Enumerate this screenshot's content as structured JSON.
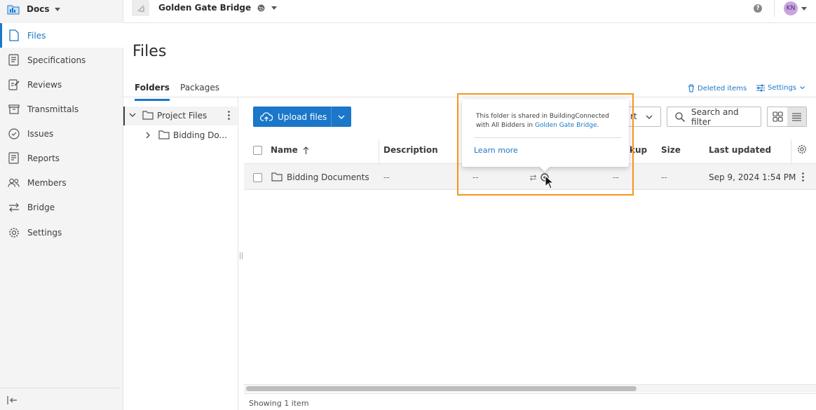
{
  "app": {
    "name": "Docs"
  },
  "project": {
    "name": "Golden Gate Bridge"
  },
  "user": {
    "initials": "KN"
  },
  "sidebar": {
    "items": [
      {
        "label": "Files"
      },
      {
        "label": "Specifications"
      },
      {
        "label": "Reviews"
      },
      {
        "label": "Transmittals"
      },
      {
        "label": "Issues"
      },
      {
        "label": "Reports"
      },
      {
        "label": "Members"
      },
      {
        "label": "Bridge"
      },
      {
        "label": "Settings"
      }
    ]
  },
  "page": {
    "title": "Files",
    "tabs": [
      {
        "label": "Folders"
      },
      {
        "label": "Packages"
      }
    ],
    "deleted_items": "Deleted items",
    "settings": "Settings"
  },
  "tree": {
    "root": "Project Files",
    "child": "Bidding Do..."
  },
  "toolbar": {
    "upload": "Upload files",
    "export_partial": "rt",
    "search_filter": "Search and filter"
  },
  "table": {
    "columns": {
      "name": "Name",
      "description": "Description",
      "markup_partial": "kup",
      "size": "Size",
      "last_updated": "Last updated"
    },
    "rows": [
      {
        "name": "Bidding Documents",
        "description": "--",
        "version": "--",
        "markup": "--",
        "size": "--",
        "last_updated": "Sep 9, 2024 1:54 PM"
      }
    ]
  },
  "tooltip": {
    "text_prefix": "This folder is shared in BuildingConnected with All Bidders in ",
    "link": "Golden Gate Bridge",
    "text_suffix": ".",
    "learn_more": "Learn more"
  },
  "footer": {
    "status": "Showing 1 item"
  },
  "colors": {
    "accent": "#1a77c9",
    "highlight": "#f7941d",
    "avatar": "#c9a4e0"
  }
}
